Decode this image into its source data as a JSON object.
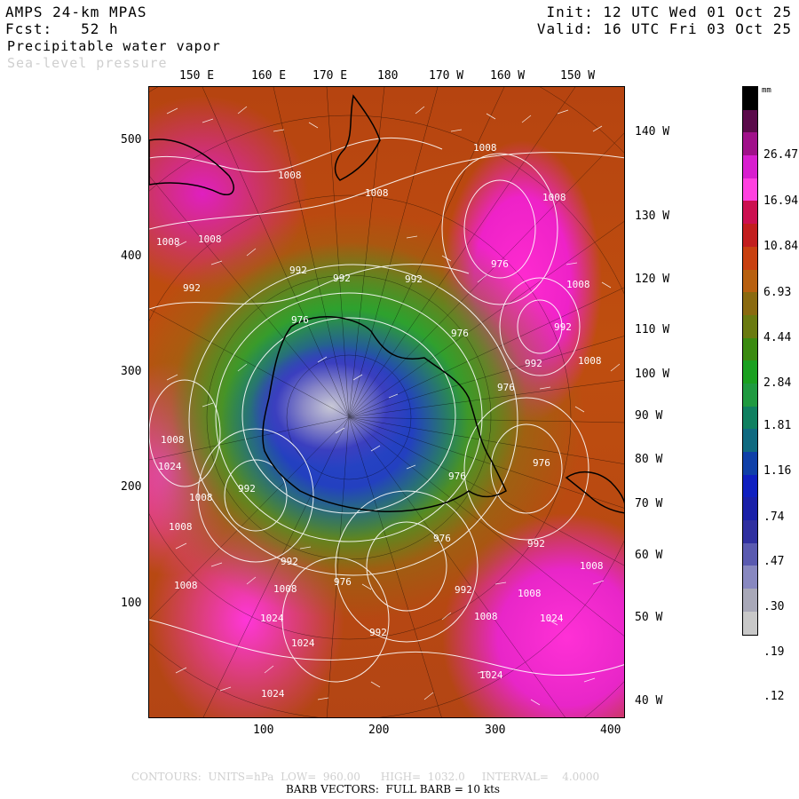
{
  "header": {
    "model": "AMPS 24-km MPAS",
    "forecast": "Fcst:   52 h",
    "field_primary": "Precipitable water vapor",
    "field_secondary": "Sea-level pressure",
    "init": "Init: 12 UTC Wed 01 Oct 25",
    "valid": "Valid: 16 UTC Fri 03 Oct 25"
  },
  "lon_top": [
    "150 E",
    "160 E",
    "170 E",
    "180",
    "170 W",
    "160 W",
    "150 W"
  ],
  "lon_right": [
    "140 W",
    "130 W",
    "120 W",
    "110 W",
    "100 W",
    "90 W",
    "80 W",
    "70 W",
    "60 W",
    "50 W",
    "40 W"
  ],
  "y_axis": [
    "500",
    "400",
    "300",
    "200",
    "100"
  ],
  "x_axis": [
    "100",
    "200",
    "300",
    "400"
  ],
  "colorbar": {
    "units": "mm",
    "labels": [
      "26.47",
      "16.94",
      "10.84",
      "6.93",
      "4.44",
      "2.84",
      "1.81",
      "1.16",
      ".74",
      ".47",
      ".30",
      ".19",
      ".12"
    ],
    "colors": [
      "#000000",
      "#5a0a4a",
      "#a0108a",
      "#d81ecf",
      "#ff40e0",
      "#cc1050",
      "#c21e1e",
      "#c84010",
      "#b86010",
      "#8a6a10",
      "#6a7a10",
      "#3a8a10",
      "#1aa020",
      "#1f9a40",
      "#108060",
      "#106a80",
      "#1040a8",
      "#1020c0",
      "#1a20a8",
      "#3030a0",
      "#5a5ab0",
      "#8888c0",
      "#a8a8b8",
      "#c8c8c8"
    ]
  },
  "map": {
    "pressure_labels": [
      "1008",
      "1008",
      "1008",
      "1008",
      "1008",
      "1008",
      "1008",
      "1008",
      "1008",
      "1008",
      "1008",
      "1008",
      "1008",
      "1008",
      "1008",
      "1008",
      "1024",
      "1024",
      "1024",
      "1024",
      "1024",
      "1024",
      "992",
      "992",
      "992",
      "992",
      "992",
      "992",
      "992",
      "992",
      "992",
      "992",
      "992",
      "976",
      "976",
      "976",
      "976",
      "976",
      "976",
      "976",
      "976"
    ]
  },
  "footer": {
    "contours": "CONTOURS:  UNITS=hPa  LOW=  960.00      HIGH=  1032.0     INTERVAL=    4.0000",
    "barbs": "BARB VECTORS:  FULL BARB = 10 kts"
  }
}
